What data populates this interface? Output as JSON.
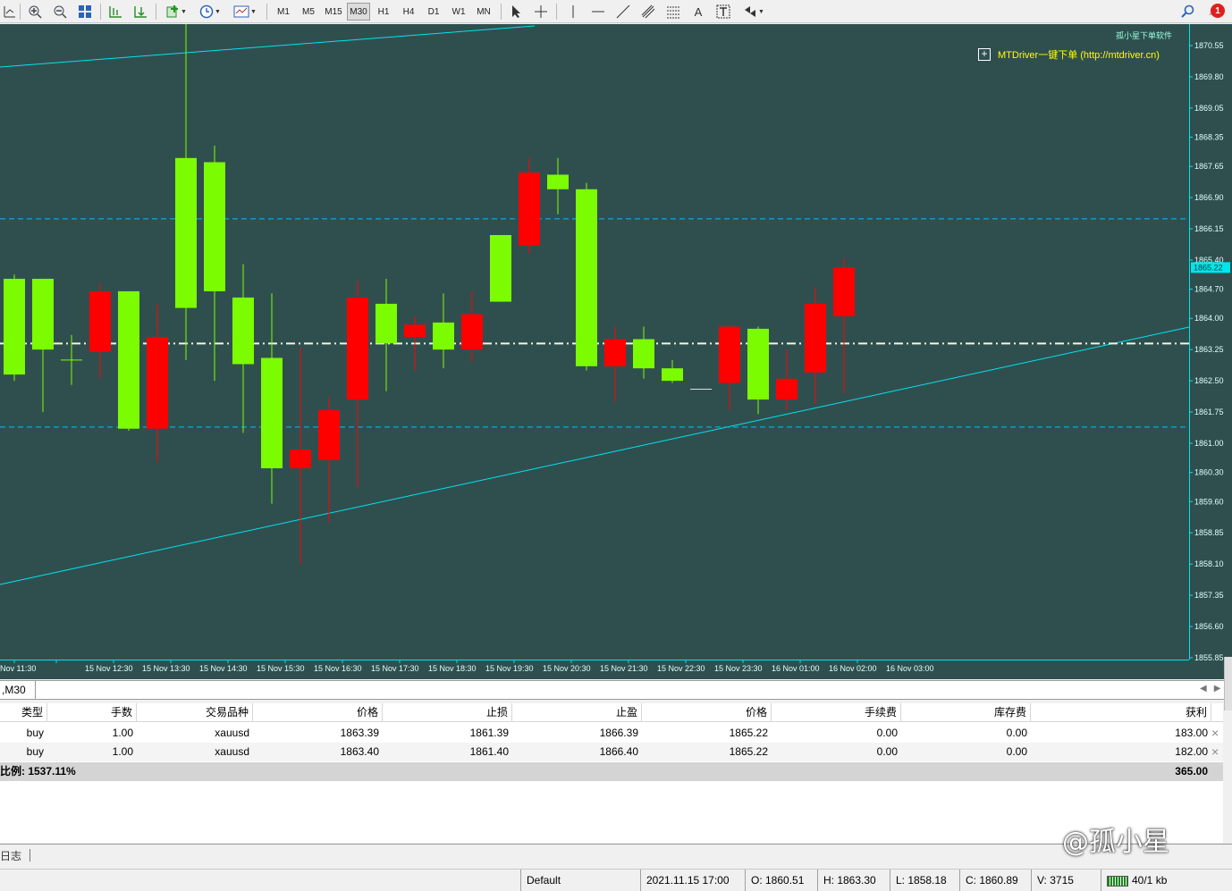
{
  "toolbar": {
    "timeframes": [
      "M1",
      "M5",
      "M15",
      "M30",
      "H1",
      "H4",
      "D1",
      "W1",
      "MN"
    ],
    "active_timeframe": "M30",
    "notification_count": "1",
    "icons": [
      "line-studies-icon",
      "zoom-in-icon",
      "zoom-out-icon",
      "tile-windows-icon",
      "chart-shift-icon",
      "autoscroll-icon",
      "indicators-icon",
      "periods-icon",
      "templates-icon",
      "cursor-icon",
      "crosshair-icon",
      "vertical-line-icon",
      "horizontal-line-icon",
      "trendline-icon",
      "fibonacci-icon",
      "channel-icon",
      "text-icon",
      "text-label-icon",
      "arrows-icon",
      "search-icon",
      "notification-icon"
    ],
    "text_tool_label": "A"
  },
  "chart": {
    "brand_text": "孤小星下单软件",
    "mtdriver_text": "MTDriver一键下单 (http://mtdriver.cn)",
    "current_price_label": "1865.22",
    "colors": {
      "background": "#2f4f4f",
      "bull": "#7cfc00",
      "bear": "#ff0000",
      "axis": "#00e5ee",
      "level": "#00bfff",
      "position_line": "#f5f5dc"
    }
  },
  "chart_data": {
    "type": "candlestick",
    "title": "",
    "y_ticks": [
      "1870.55",
      "1869.80",
      "1869.05",
      "1868.35",
      "1867.65",
      "1866.90",
      "1866.15",
      "1865.40",
      "1864.70",
      "1864.00",
      "1863.25",
      "1862.50",
      "1861.75",
      "1861.00",
      "1860.30",
      "1859.60",
      "1858.85",
      "1858.10",
      "1857.35",
      "1856.60",
      "1855.85"
    ],
    "ylim": [
      1855.85,
      1870.55
    ],
    "x_ticks": [
      "Nov 11:30",
      "15 Nov 12:30",
      "15 Nov 13:30",
      "15 Nov 14:30",
      "15 Nov 15:30",
      "15 Nov 16:30",
      "15 Nov 17:30",
      "15 Nov 18:30",
      "15 Nov 19:30",
      "15 Nov 20:30",
      "15 Nov 21:30",
      "15 Nov 22:30",
      "15 Nov 23:30",
      "16 Nov 01:00",
      "16 Nov 02:00",
      "16 Nov 03:00"
    ],
    "candles": [
      {
        "o": 1862.65,
        "h": 1865.05,
        "l": 1862.5,
        "c": 1864.95
      },
      {
        "o": 1863.25,
        "h": 1864.95,
        "l": 1861.75,
        "c": 1864.95
      },
      {
        "o": 1863.0,
        "h": 1863.6,
        "l": 1862.4,
        "c": 1863.0
      },
      {
        "o": 1864.65,
        "h": 1864.85,
        "l": 1862.55,
        "c": 1863.2
      },
      {
        "o": 1861.35,
        "h": 1864.65,
        "l": 1861.3,
        "c": 1864.65
      },
      {
        "o": 1863.55,
        "h": 1864.35,
        "l": 1860.55,
        "c": 1861.35
      },
      {
        "o": 1864.25,
        "h": 1872.7,
        "l": 1863.0,
        "c": 1867.85
      },
      {
        "o": 1864.65,
        "h": 1868.15,
        "l": 1862.5,
        "c": 1867.75
      },
      {
        "o": 1862.9,
        "h": 1865.3,
        "l": 1861.25,
        "c": 1864.5
      },
      {
        "o": 1860.4,
        "h": 1864.6,
        "l": 1859.55,
        "c": 1863.05
      },
      {
        "o": 1860.85,
        "h": 1863.3,
        "l": 1858.1,
        "c": 1860.4
      },
      {
        "o": 1861.8,
        "h": 1862.1,
        "l": 1859.1,
        "c": 1860.6
      },
      {
        "o": 1864.5,
        "h": 1864.9,
        "l": 1859.95,
        "c": 1862.05
      },
      {
        "o": 1863.4,
        "h": 1864.95,
        "l": 1862.25,
        "c": 1864.35
      },
      {
        "o": 1863.85,
        "h": 1864.05,
        "l": 1862.75,
        "c": 1863.55
      },
      {
        "o": 1863.25,
        "h": 1864.6,
        "l": 1862.8,
        "c": 1863.9
      },
      {
        "o": 1864.1,
        "h": 1864.65,
        "l": 1862.95,
        "c": 1863.25
      },
      {
        "o": 1864.4,
        "h": 1866.0,
        "l": 1864.4,
        "c": 1866.0
      },
      {
        "o": 1867.5,
        "h": 1867.85,
        "l": 1865.55,
        "c": 1865.75
      },
      {
        "o": 1867.1,
        "h": 1867.85,
        "l": 1866.5,
        "c": 1867.45
      },
      {
        "o": 1862.85,
        "h": 1867.25,
        "l": 1862.75,
        "c": 1867.1
      },
      {
        "o": 1863.5,
        "h": 1863.8,
        "l": 1862.0,
        "c": 1862.85
      },
      {
        "o": 1862.8,
        "h": 1863.8,
        "l": 1862.55,
        "c": 1863.5
      },
      {
        "o": 1862.5,
        "h": 1863.0,
        "l": 1862.45,
        "c": 1862.8
      },
      {
        "o": 1862.3,
        "h": 1862.3,
        "l": 1862.3,
        "c": 1862.3
      },
      {
        "o": 1863.8,
        "h": 1863.85,
        "l": 1861.8,
        "c": 1862.45
      },
      {
        "o": 1862.05,
        "h": 1863.8,
        "l": 1861.7,
        "c": 1863.75
      },
      {
        "o": 1862.55,
        "h": 1863.25,
        "l": 1861.8,
        "c": 1862.05
      },
      {
        "o": 1864.35,
        "h": 1864.75,
        "l": 1861.95,
        "c": 1862.7
      },
      {
        "o": 1865.22,
        "h": 1865.45,
        "l": 1862.2,
        "c": 1864.05
      }
    ],
    "levels": [
      {
        "price": 1866.39,
        "style": "dashed",
        "color": "#00bfff"
      },
      {
        "price": 1863.395,
        "style": "dash-dot",
        "color": "#f5f5dc"
      },
      {
        "price": 1861.39,
        "style": "dashed",
        "color": "#00bfff"
      }
    ]
  },
  "symbol_tab": {
    "label": ",M30"
  },
  "trade": {
    "columns": [
      "类型",
      "手数",
      "交易品种",
      "价格",
      "止损",
      "止盈",
      "价格",
      "手续费",
      "库存费",
      "获利"
    ],
    "rows": [
      [
        "buy",
        "1.00",
        "xauusd",
        "1863.39",
        "1861.39",
        "1866.39",
        "1865.22",
        "0.00",
        "0.00",
        "183.00"
      ],
      [
        "buy",
        "1.00",
        "xauusd",
        "1863.40",
        "1861.40",
        "1866.40",
        "1865.22",
        "0.00",
        "0.00",
        "182.00"
      ]
    ],
    "total_label": "比例: 1537.11%",
    "total_profit": "365.00",
    "close_glyph": "×"
  },
  "bottom": {
    "journal_tab": "日志",
    "watermark": "@孤小星"
  },
  "status": {
    "profile": "Default",
    "datetime": "2021.11.15 17:00",
    "open": "O: 1860.51",
    "high": "H: 1863.30",
    "low": "L: 1858.18",
    "close": "C: 1860.89",
    "volume": "V: 3715",
    "traffic": "40/1 kb"
  }
}
